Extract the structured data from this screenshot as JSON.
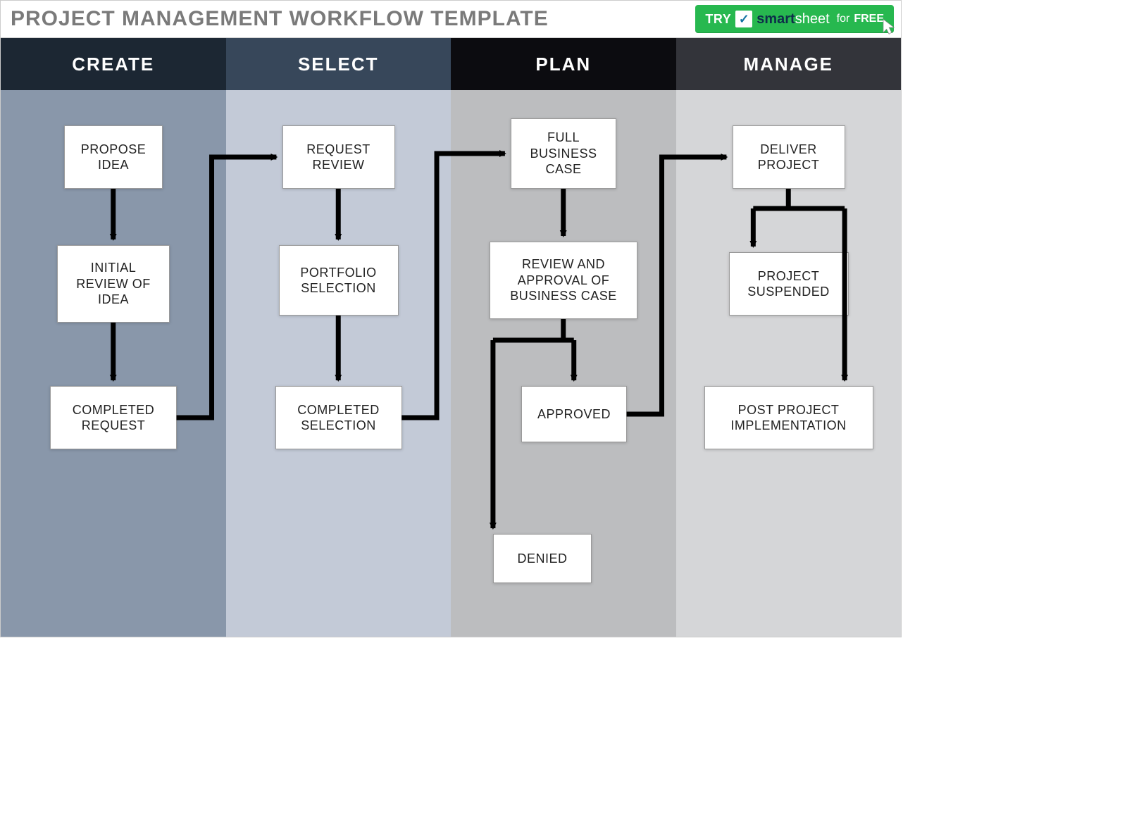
{
  "header": {
    "title": "PROJECT MANAGEMENT WORKFLOW TEMPLATE",
    "cta": {
      "try": "TRY",
      "brand_smart": "smart",
      "brand_sheet": "sheet",
      "for": "for",
      "free": "FREE"
    }
  },
  "columns": [
    {
      "label": "CREATE",
      "head_color": "#1c2733",
      "body_color": "#8997aa"
    },
    {
      "label": "SELECT",
      "head_color": "#37475a",
      "body_color": "#c3cad7"
    },
    {
      "label": "PLAN",
      "head_color": "#0c0c10",
      "body_color": "#bcbdbf"
    },
    {
      "label": "MANAGE",
      "head_color": "#33343a",
      "body_color": "#d5d6d8"
    }
  ],
  "boxes": {
    "propose_idea": "PROPOSE IDEA",
    "initial_review": "INITIAL REVIEW OF IDEA",
    "completed_request": "COMPLETED REQUEST",
    "request_review": "REQUEST REVIEW",
    "portfolio_selection": "PORTFOLIO SELECTION",
    "completed_selection": "COMPLETED SELECTION",
    "full_business_case": "FULL BUSINESS CASE",
    "review_approval": "REVIEW AND APPROVAL OF BUSINESS CASE",
    "approved": "APPROVED",
    "denied": "DENIED",
    "deliver_project": "DELIVER PROJECT",
    "project_suspended": "PROJECT SUSPENDED",
    "post_project_impl": "POST PROJECT IMPLEMENTATION"
  }
}
